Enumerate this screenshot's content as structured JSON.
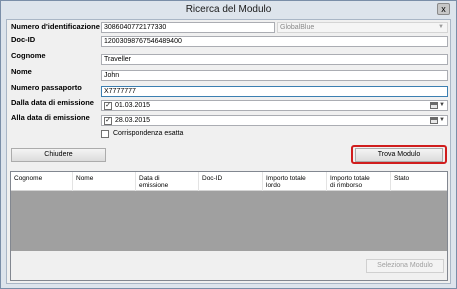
{
  "window": {
    "title": "Ricerca del Modulo",
    "close_glyph": "x"
  },
  "form": {
    "id_number": {
      "label": "Numero d'identificazione",
      "value": "3086040772177330"
    },
    "source": {
      "value": "GlobalBlue"
    },
    "doc_id": {
      "label": "Doc-ID",
      "value": "120030987675464​89400"
    },
    "surname": {
      "label": "Cognome",
      "value": "Traveller"
    },
    "name": {
      "label": "Nome",
      "value": "John"
    },
    "passport": {
      "label": "Numero passaporto",
      "value": "X7777777"
    },
    "date_from": {
      "label": "Dalla data di emissione",
      "value": "01.03.2015",
      "checked": "✓"
    },
    "date_to": {
      "label": "Alla data di emissione",
      "value": "28.03.2015",
      "checked": "✓"
    },
    "exact_match": {
      "label": "Corrispondenza esatta"
    }
  },
  "buttons": {
    "close": "Chiudere",
    "find": "Trova Modulo",
    "select": "Seleziona Modulo"
  },
  "table": {
    "columns": [
      "Cognome",
      "Nome",
      "Data di\nemissione",
      "Doc-ID",
      "Importo totale\nlordo",
      "Importo totale\ndi rimborso",
      "Stato"
    ],
    "rows": []
  },
  "colors": {
    "highlight": "#d01d1d",
    "grid_empty": "#a0a0a0"
  }
}
